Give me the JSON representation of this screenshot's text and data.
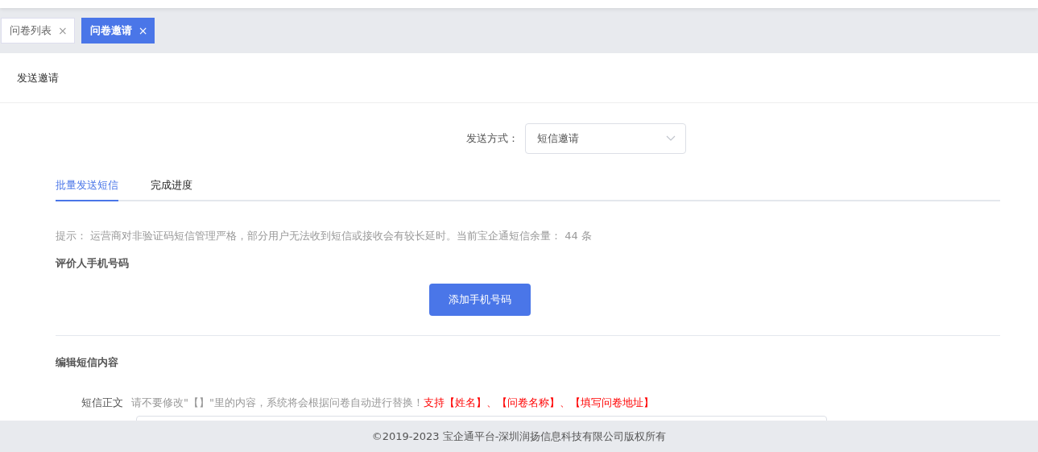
{
  "tabs": [
    {
      "label": "问卷列表",
      "close": "×",
      "selected": false
    },
    {
      "label": "问卷邀请",
      "close": "×",
      "selected": true
    }
  ],
  "page_title": "发送邀请",
  "send_method": {
    "label": "发送方式：",
    "value": "短信邀请"
  },
  "sub_tabs": [
    {
      "label": "批量发送短信",
      "selected": true
    },
    {
      "label": "完成进度",
      "selected": false
    }
  ],
  "notice": "提示： 运营商对非验证码短信管理严格，部分用户无法收到短信或接收会有较长延时。当前宝企通短信余量： 44 条",
  "phone_section": {
    "title": "评价人手机号码",
    "button": "添加手机号码"
  },
  "content_section": {
    "title": "编辑短信内容",
    "field_label": "短信正文",
    "hint": "请不要修改\"【】\"里的内容，系统将会根据问卷自动进行替换！",
    "supported": "支持【姓名】、【问卷名称】、【填写问卷地址】"
  },
  "footer": "©2019-2023 宝企通平台-深圳润扬信息科技有限公司版权所有"
}
